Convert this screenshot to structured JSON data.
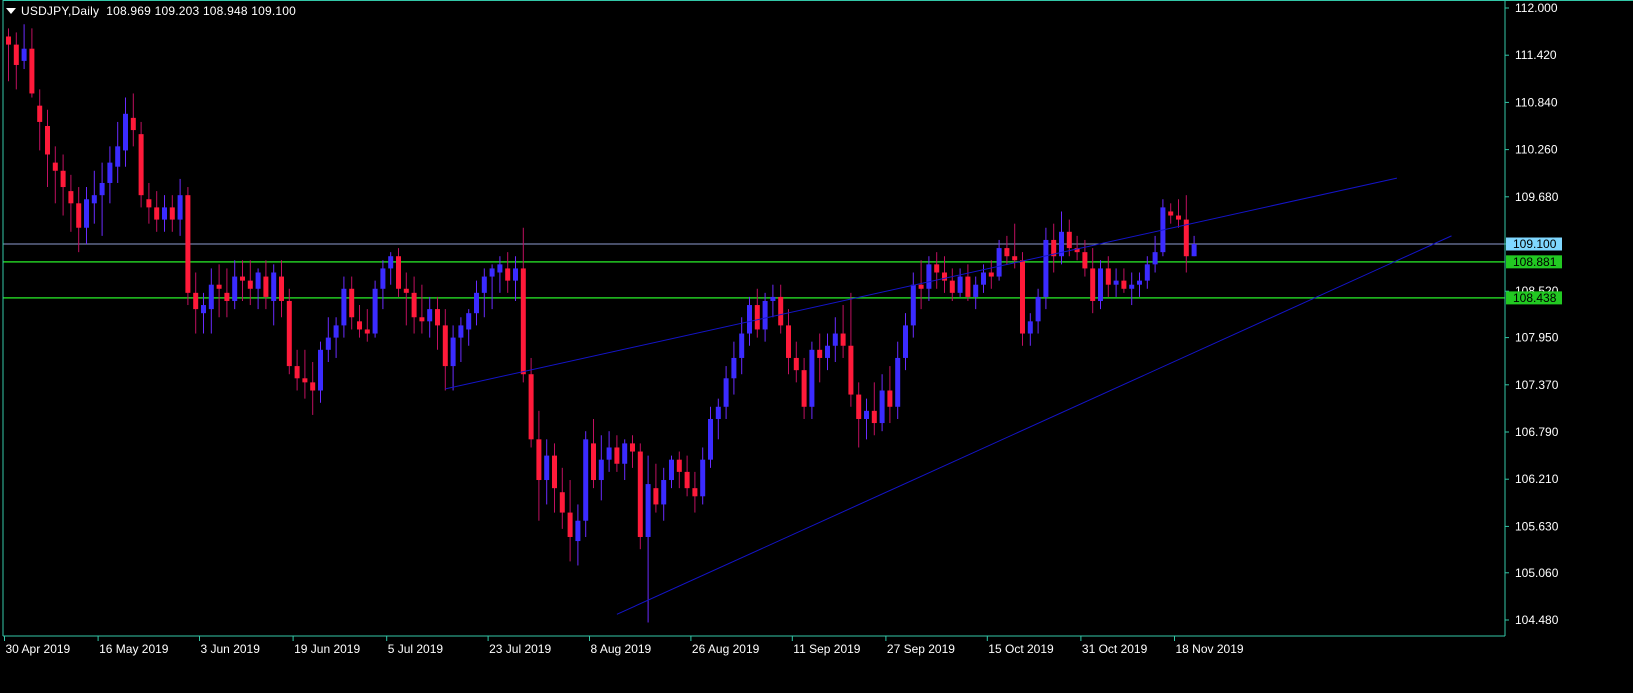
{
  "header": {
    "symbol": "USDJPY,Daily",
    "open": "108.969",
    "high": "109.203",
    "low": "108.948",
    "close": "109.100"
  },
  "colors": {
    "background": "#000000",
    "axis": "#33c7a8",
    "axis_text": "#ffffff",
    "bull": "#3b2bff",
    "bear": "#ff1a3a",
    "wick_bull": "#6a2bff",
    "wick_bear": "#c01060",
    "trendline": "#1414c8",
    "bid_line": "#8e9dd1",
    "level_line": "#22c922",
    "bid_label_bg": "#7fd7ff",
    "level_label_bg": "#22c922"
  },
  "chart_data": {
    "type": "candlestick",
    "title": "USDJPY,Daily",
    "ylim": [
      104.48,
      112.0
    ],
    "yticks": [
      "112.000",
      "111.420",
      "110.840",
      "110.260",
      "109.680",
      "109.100",
      "108.520",
      "107.950",
      "107.370",
      "106.790",
      "106.210",
      "105.630",
      "105.060",
      "104.480"
    ],
    "xticks": [
      "30 Apr 2019",
      "16 May 2019",
      "3 Jun 2019",
      "19 Jun 2019",
      "5 Jul 2019",
      "23 Jul 2019",
      "8 Aug 2019",
      "26 Aug 2019",
      "11 Sep 2019",
      "27 Sep 2019",
      "15 Oct 2019",
      "31 Oct 2019",
      "18 Nov 2019"
    ],
    "price_labels": [
      {
        "name": "bid",
        "value": "109.100"
      },
      {
        "name": "level-upper",
        "value": "108.881"
      },
      {
        "name": "level-lower",
        "value": "108.438"
      }
    ],
    "horizontal_lines": [
      109.1,
      108.881,
      108.438
    ],
    "trendlines": [
      {
        "name": "upper-channel",
        "from": [
          56,
          107.32
        ],
        "to": [
          178,
          109.91
        ]
      },
      {
        "name": "lower-channel",
        "from": [
          78,
          104.55
        ],
        "to": [
          185,
          109.2
        ]
      }
    ],
    "candles": [
      [
        111.65,
        111.75,
        111.1,
        111.55
      ],
      [
        111.55,
        111.7,
        111.0,
        111.3
      ],
      [
        111.35,
        111.8,
        111.25,
        111.5
      ],
      [
        111.5,
        111.75,
        110.9,
        110.95
      ],
      [
        110.8,
        111.0,
        110.25,
        110.6
      ],
      [
        110.55,
        110.75,
        109.8,
        110.2
      ],
      [
        110.1,
        110.3,
        109.6,
        110.0
      ],
      [
        110.0,
        110.2,
        109.45,
        109.8
      ],
      [
        109.75,
        109.95,
        109.25,
        109.6
      ],
      [
        109.6,
        109.8,
        109.0,
        109.3
      ],
      [
        109.3,
        109.8,
        109.1,
        109.65
      ],
      [
        109.6,
        110.0,
        109.35,
        109.7
      ],
      [
        109.7,
        110.1,
        109.2,
        109.85
      ],
      [
        109.85,
        110.3,
        109.6,
        110.1
      ],
      [
        110.05,
        110.6,
        109.85,
        110.3
      ],
      [
        110.25,
        110.9,
        110.05,
        110.7
      ],
      [
        110.65,
        110.95,
        110.3,
        110.5
      ],
      [
        110.45,
        110.6,
        109.55,
        109.7
      ],
      [
        109.65,
        109.85,
        109.35,
        109.55
      ],
      [
        109.55,
        109.75,
        109.25,
        109.4
      ],
      [
        109.4,
        109.7,
        109.25,
        109.55
      ],
      [
        109.55,
        109.7,
        109.25,
        109.4
      ],
      [
        109.4,
        109.9,
        109.2,
        109.7
      ],
      [
        109.7,
        109.8,
        108.35,
        108.5
      ],
      [
        108.5,
        108.75,
        108.0,
        108.3
      ],
      [
        108.25,
        108.5,
        108.0,
        108.35
      ],
      [
        108.3,
        108.8,
        108.0,
        108.6
      ],
      [
        108.6,
        108.85,
        108.2,
        108.55
      ],
      [
        108.5,
        108.8,
        108.2,
        108.4
      ],
      [
        108.4,
        108.9,
        108.3,
        108.7
      ],
      [
        108.7,
        108.9,
        108.4,
        108.65
      ],
      [
        108.65,
        108.9,
        108.35,
        108.55
      ],
      [
        108.55,
        108.8,
        108.3,
        108.75
      ],
      [
        108.7,
        108.9,
        108.3,
        108.45
      ],
      [
        108.4,
        108.85,
        108.1,
        108.75
      ],
      [
        108.7,
        108.9,
        108.2,
        108.4
      ],
      [
        108.4,
        108.55,
        107.5,
        107.6
      ],
      [
        107.6,
        107.8,
        107.3,
        107.45
      ],
      [
        107.45,
        107.8,
        107.2,
        107.4
      ],
      [
        107.4,
        107.65,
        107.0,
        107.3
      ],
      [
        107.3,
        107.9,
        107.15,
        107.8
      ],
      [
        107.8,
        108.2,
        107.65,
        107.95
      ],
      [
        107.95,
        108.2,
        107.7,
        108.1
      ],
      [
        108.1,
        108.7,
        107.95,
        108.55
      ],
      [
        108.55,
        108.7,
        108.05,
        108.2
      ],
      [
        108.15,
        108.35,
        107.95,
        108.05
      ],
      [
        108.05,
        108.3,
        107.9,
        108.0
      ],
      [
        108.0,
        108.65,
        107.95,
        108.55
      ],
      [
        108.55,
        108.9,
        108.3,
        108.8
      ],
      [
        108.8,
        109.0,
        108.6,
        108.95
      ],
      [
        108.95,
        109.05,
        108.45,
        108.55
      ],
      [
        108.55,
        108.75,
        108.1,
        108.5
      ],
      [
        108.5,
        108.7,
        108.0,
        108.2
      ],
      [
        108.2,
        108.6,
        108.0,
        108.15
      ],
      [
        108.15,
        108.45,
        107.95,
        108.3
      ],
      [
        108.3,
        108.45,
        107.8,
        108.1
      ],
      [
        108.1,
        108.3,
        107.3,
        107.6
      ],
      [
        107.6,
        108.1,
        107.3,
        107.95
      ],
      [
        107.95,
        108.2,
        107.65,
        108.1
      ],
      [
        108.05,
        108.3,
        107.85,
        108.25
      ],
      [
        108.25,
        108.65,
        108.1,
        108.5
      ],
      [
        108.5,
        108.8,
        108.2,
        108.7
      ],
      [
        108.7,
        108.85,
        108.3,
        108.8
      ],
      [
        108.75,
        108.95,
        108.5,
        108.85
      ],
      [
        108.8,
        109.0,
        108.5,
        108.65
      ],
      [
        108.65,
        108.95,
        108.4,
        108.8
      ],
      [
        108.8,
        109.3,
        107.4,
        107.5
      ],
      [
        107.5,
        107.7,
        106.6,
        106.7
      ],
      [
        106.7,
        107.05,
        105.7,
        106.2
      ],
      [
        106.2,
        106.7,
        105.9,
        106.5
      ],
      [
        106.5,
        106.65,
        105.8,
        106.1
      ],
      [
        106.05,
        106.35,
        105.6,
        105.8
      ],
      [
        105.8,
        106.2,
        105.2,
        105.5
      ],
      [
        105.45,
        105.9,
        105.15,
        105.7
      ],
      [
        105.7,
        106.8,
        105.5,
        106.7
      ],
      [
        106.65,
        106.95,
        106.1,
        106.2
      ],
      [
        106.2,
        106.75,
        105.95,
        106.45
      ],
      [
        106.45,
        106.8,
        106.3,
        106.6
      ],
      [
        106.6,
        106.75,
        106.3,
        106.4
      ],
      [
        106.4,
        106.7,
        106.2,
        106.65
      ],
      [
        106.65,
        106.75,
        106.35,
        106.55
      ],
      [
        106.55,
        106.65,
        105.35,
        105.5
      ],
      [
        105.5,
        106.5,
        104.45,
        106.15
      ],
      [
        106.1,
        106.4,
        105.8,
        105.9
      ],
      [
        105.9,
        106.35,
        105.7,
        106.2
      ],
      [
        106.2,
        106.5,
        106.1,
        106.45
      ],
      [
        106.45,
        106.55,
        106.1,
        106.3
      ],
      [
        106.3,
        106.5,
        106.0,
        106.1
      ],
      [
        106.1,
        106.3,
        105.8,
        106.0
      ],
      [
        106.0,
        106.6,
        105.9,
        106.45
      ],
      [
        106.45,
        107.1,
        106.35,
        106.95
      ],
      [
        106.95,
        107.2,
        106.7,
        107.1
      ],
      [
        107.1,
        107.6,
        106.95,
        107.45
      ],
      [
        107.45,
        107.9,
        107.25,
        107.7
      ],
      [
        107.7,
        108.2,
        107.5,
        108.0
      ],
      [
        108.0,
        108.45,
        107.85,
        108.35
      ],
      [
        108.35,
        108.55,
        107.95,
        108.05
      ],
      [
        108.05,
        108.5,
        107.9,
        108.4
      ],
      [
        108.4,
        108.6,
        108.2,
        108.45
      ],
      [
        108.45,
        108.6,
        108.0,
        108.1
      ],
      [
        108.1,
        108.3,
        107.5,
        107.7
      ],
      [
        107.7,
        107.9,
        107.4,
        107.55
      ],
      [
        107.55,
        107.7,
        106.95,
        107.1
      ],
      [
        107.1,
        107.9,
        106.95,
        107.8
      ],
      [
        107.8,
        108.0,
        107.4,
        107.7
      ],
      [
        107.7,
        108.0,
        107.55,
        107.85
      ],
      [
        107.85,
        108.2,
        107.65,
        108.0
      ],
      [
        108.0,
        108.35,
        107.7,
        107.85
      ],
      [
        107.85,
        108.5,
        107.1,
        107.25
      ],
      [
        107.25,
        107.4,
        106.6,
        106.95
      ],
      [
        106.95,
        107.2,
        106.7,
        107.05
      ],
      [
        107.05,
        107.4,
        106.75,
        106.9
      ],
      [
        106.9,
        107.5,
        106.8,
        107.3
      ],
      [
        107.3,
        107.6,
        106.9,
        107.1
      ],
      [
        107.1,
        107.9,
        106.95,
        107.7
      ],
      [
        107.7,
        108.25,
        107.55,
        108.1
      ],
      [
        108.1,
        108.75,
        107.95,
        108.6
      ],
      [
        108.6,
        108.9,
        108.3,
        108.55
      ],
      [
        108.55,
        108.95,
        108.4,
        108.85
      ],
      [
        108.85,
        109.0,
        108.55,
        108.75
      ],
      [
        108.75,
        108.95,
        108.5,
        108.65
      ],
      [
        108.65,
        108.8,
        108.4,
        108.5
      ],
      [
        108.5,
        108.8,
        108.45,
        108.7
      ],
      [
        108.7,
        108.85,
        108.4,
        108.45
      ],
      [
        108.45,
        108.7,
        108.3,
        108.6
      ],
      [
        108.6,
        108.85,
        108.5,
        108.75
      ],
      [
        108.75,
        108.9,
        108.55,
        108.7
      ],
      [
        108.7,
        109.15,
        108.65,
        109.05
      ],
      [
        109.05,
        109.2,
        108.85,
        108.95
      ],
      [
        108.95,
        109.35,
        108.8,
        108.9
      ],
      [
        108.9,
        109.0,
        107.85,
        108.0
      ],
      [
        108.0,
        108.25,
        107.85,
        108.15
      ],
      [
        108.15,
        108.55,
        108.0,
        108.45
      ],
      [
        108.45,
        109.3,
        108.3,
        109.15
      ],
      [
        109.15,
        109.35,
        108.75,
        108.95
      ],
      [
        108.95,
        109.5,
        108.85,
        109.25
      ],
      [
        109.25,
        109.4,
        108.95,
        109.05
      ],
      [
        109.05,
        109.2,
        108.9,
        109.0
      ],
      [
        109.0,
        109.15,
        108.7,
        108.8
      ],
      [
        108.8,
        109.05,
        108.25,
        108.4
      ],
      [
        108.4,
        108.9,
        108.3,
        108.8
      ],
      [
        108.8,
        108.95,
        108.45,
        108.6
      ],
      [
        108.6,
        108.8,
        108.45,
        108.65
      ],
      [
        108.65,
        108.8,
        108.5,
        108.55
      ],
      [
        108.55,
        108.75,
        108.35,
        108.6
      ],
      [
        108.6,
        108.75,
        108.45,
        108.65
      ],
      [
        108.65,
        108.95,
        108.55,
        108.85
      ],
      [
        108.85,
        109.2,
        108.75,
        109.0
      ],
      [
        109.0,
        109.65,
        108.95,
        109.55
      ],
      [
        109.5,
        109.6,
        109.35,
        109.45
      ],
      [
        109.45,
        109.65,
        109.3,
        109.4
      ],
      [
        109.4,
        109.7,
        108.75,
        108.95
      ],
      [
        108.95,
        109.2,
        108.95,
        109.1
      ]
    ]
  }
}
